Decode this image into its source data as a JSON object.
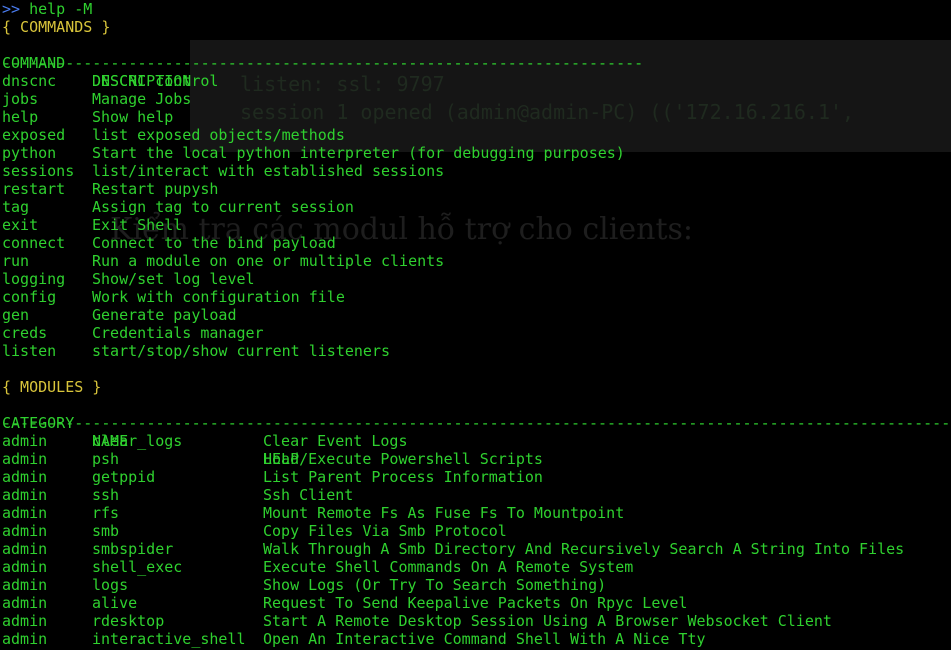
{
  "prompt": {
    "symbol": ">>",
    "command": "help -M"
  },
  "commands_section": {
    "title": "{ COMMANDS }",
    "headers": [
      "COMMAND",
      "DESCRIPTION"
    ],
    "divider": "-----------------------------------------------------------------------",
    "rows": [
      {
        "command": "dnscnc",
        "description": "DNSCNC control"
      },
      {
        "command": "jobs",
        "description": "Manage Jobs"
      },
      {
        "command": "help",
        "description": "Show help"
      },
      {
        "command": "exposed",
        "description": "list exposed objects/methods"
      },
      {
        "command": "python",
        "description": "Start the local python interpreter (for debugging purposes)"
      },
      {
        "command": "sessions",
        "description": "list/interact with established sessions"
      },
      {
        "command": "restart",
        "description": "Restart pupysh"
      },
      {
        "command": "tag",
        "description": "Assign tag to current session"
      },
      {
        "command": "exit",
        "description": "Exit Shell"
      },
      {
        "command": "connect",
        "description": "Connect to the bind payload"
      },
      {
        "command": "run",
        "description": "Run a module on one or multiple clients"
      },
      {
        "command": "logging",
        "description": "Show/set log level"
      },
      {
        "command": "config",
        "description": "Work with configuration file"
      },
      {
        "command": "gen",
        "description": "Generate payload"
      },
      {
        "command": "creds",
        "description": "Credentials manager"
      },
      {
        "command": "listen",
        "description": "start/stop/show current listeners"
      }
    ]
  },
  "modules_section": {
    "title": "{ MODULES }",
    "headers": [
      "CATEGORY",
      "NAME",
      "HELP"
    ],
    "divider": "-------------------------------------------------------------------------------------------------------------------------",
    "rows": [
      {
        "category": "admin",
        "name": "clear_logs",
        "help": "Clear Event Logs"
      },
      {
        "category": "admin",
        "name": "psh",
        "help": "Load/Execute Powershell Scripts"
      },
      {
        "category": "admin",
        "name": "getppid",
        "help": "List Parent Process Information"
      },
      {
        "category": "admin",
        "name": "ssh",
        "help": "Ssh Client"
      },
      {
        "category": "admin",
        "name": "rfs",
        "help": "Mount Remote Fs As Fuse Fs To Mountpoint"
      },
      {
        "category": "admin",
        "name": "smb",
        "help": "Copy Files Via Smb Protocol"
      },
      {
        "category": "admin",
        "name": "smbspider",
        "help": "Walk Through A Smb Directory And Recursively Search A String Into Files"
      },
      {
        "category": "admin",
        "name": "shell_exec",
        "help": "Execute Shell Commands On A Remote System"
      },
      {
        "category": "admin",
        "name": "logs",
        "help": "Show Logs (Or Try To Search Something)"
      },
      {
        "category": "admin",
        "name": "alive",
        "help": "Request To Send Keepalive Packets On Rpyc Level"
      },
      {
        "category": "admin",
        "name": "rdesktop",
        "help": "Start A Remote Desktop Session Using A Browser Websocket Client"
      },
      {
        "category": "admin",
        "name": "interactive_shell",
        "help": "Open An Interactive Command Shell With A Nice Tty"
      }
    ]
  },
  "colors": {
    "background": "#000000",
    "text_green": "#2fd12f",
    "prompt_blue": "#4a7cf0",
    "section_yellow": "#d9c53b"
  }
}
